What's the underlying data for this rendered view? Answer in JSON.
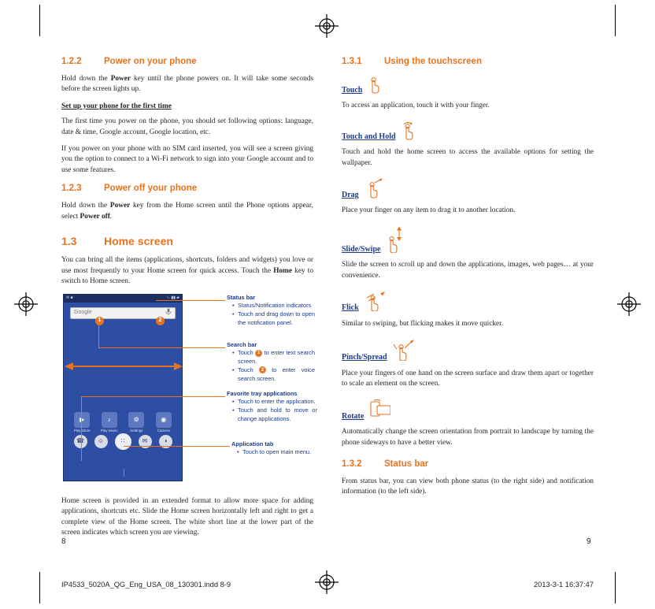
{
  "document": {
    "left_page_number": "8",
    "right_page_number": "9",
    "footer_file": "IP4533_5020A_QG_Eng_USA_08_130301.indd   8-9",
    "footer_date": "2013-3-1   16:37:47"
  },
  "left_column": {
    "s122": {
      "num": "1.2.2",
      "title": "Power on your phone",
      "p1_before": "Hold down the ",
      "p1_bold": "Power",
      "p1_after": " key until the phone powers on. It will take some seconds before the screen lights up."
    },
    "setup": {
      "heading": "Set up your phone for the first time",
      "p1": "The first time you power on the phone, you should set following options: language, date & time, Google account, Google location, etc.",
      "p2": "If you power on your phone with no SIM card inserted, you will see a screen giving you the option to connect to a Wi-Fi network to sign into your Google account and to use some features."
    },
    "s123": {
      "num": "1.2.3",
      "title": "Power off your phone",
      "p1_before": "Hold down the ",
      "p1_bold1": "Power",
      "p1_mid": " key from the Home screen until the Phone options appear, select ",
      "p1_bold2": "Power off",
      "p1_after": "."
    },
    "s13": {
      "num": "1.3",
      "title": "Home screen",
      "p1_before": "You can bring all the items (applications, shortcuts, folders and widgets) you love or use most frequently to your Home screen for quick access. Touch the ",
      "p1_bold": "Home",
      "p1_after": " key to switch to Home screen."
    },
    "closing": "Home screen is provided in an extended format to allow more space for adding applications, shortcuts etc. Slide the Home screen horizontally left and right to get a complete view of the Home screen. The white short line at the lower part of the screen indicates which screen you are viewing."
  },
  "phone": {
    "status_left_icons": "✉ ■",
    "status_right_icons": "↑↓  ▮▮  ▰",
    "search_placeholder": "Google",
    "search_mic_glyph": "☰",
    "dock_apps": [
      {
        "label": "Play Store",
        "glyph": "▶"
      },
      {
        "label": "Play Music",
        "glyph": "♪"
      },
      {
        "label": "Settings",
        "glyph": "⚙"
      },
      {
        "label": "Camera",
        "glyph": "◉"
      }
    ],
    "tray_icons": [
      {
        "name": "phone-icon",
        "glyph": "☎"
      },
      {
        "name": "contacts-icon",
        "glyph": "☺"
      },
      {
        "name": "app-tab-icon",
        "glyph": "∷"
      },
      {
        "name": "messaging-icon",
        "glyph": "✉"
      },
      {
        "name": "browser-icon",
        "glyph": "◑"
      }
    ],
    "badges": {
      "one": "1",
      "two": "2"
    }
  },
  "callouts": {
    "status_bar": {
      "title": "Status bar",
      "items": [
        "Status/Notification indicators",
        "Touch and drag down to open the notification panel."
      ]
    },
    "search_bar": {
      "title": "Search bar",
      "item1_a": "Touch ",
      "item1_badge": "1",
      "item1_b": " to enter text search screen.",
      "item2_a": "Touch ",
      "item2_badge": "2",
      "item2_b": " to enter voice search screen."
    },
    "favorite_tray": {
      "title": "Favorite tray applications",
      "items": [
        "Touch to enter the application.",
        "Touch and hold to move or change applications."
      ]
    },
    "application_tab": {
      "title": "Application tab",
      "items": [
        "Touch to open main menu."
      ]
    }
  },
  "right_column": {
    "s131": {
      "num": "1.3.1",
      "title": "Using the touchscreen"
    },
    "gestures": [
      {
        "name": "Touch",
        "icon": "touch-gesture-icon",
        "text": "To access an application, touch it with your finger."
      },
      {
        "name": "Touch and Hold",
        "icon": "touch-and-hold-gesture-icon",
        "text": "Touch and hold the home screen to access the available options for setting the wallpaper."
      },
      {
        "name": "Drag",
        "icon": "drag-gesture-icon",
        "text": "Place your finger on any item to drag it to another location."
      },
      {
        "name": "Slide/Swipe",
        "icon": "slide-swipe-gesture-icon",
        "text": "Slide the screen to scroll up and down the applications, images, web pages… at your convenience."
      },
      {
        "name": "Flick",
        "icon": "flick-gesture-icon",
        "text": "Similar to swiping, but flicking makes it move quicker."
      },
      {
        "name": "Pinch/Spread",
        "icon": "pinch-spread-gesture-icon",
        "text": "Place your fingers of one hand on the screen surface and draw them apart or together to scale an element on the screen."
      },
      {
        "name": "Rotate",
        "icon": "rotate-gesture-icon",
        "text": "Automatically change the screen orientation from portrait to landscape by turning the phone sideways to have a better view."
      }
    ],
    "s132": {
      "num": "1.3.2",
      "title": "Status bar",
      "text": "From status bar, you can view both phone status (to the right side) and notification information (to the left side)."
    }
  },
  "colors": {
    "accent_orange": "#e8731e",
    "heading_blue": "#1b3a8c",
    "body_text": "#231f20",
    "phone_bg": "#2d4ea2"
  }
}
